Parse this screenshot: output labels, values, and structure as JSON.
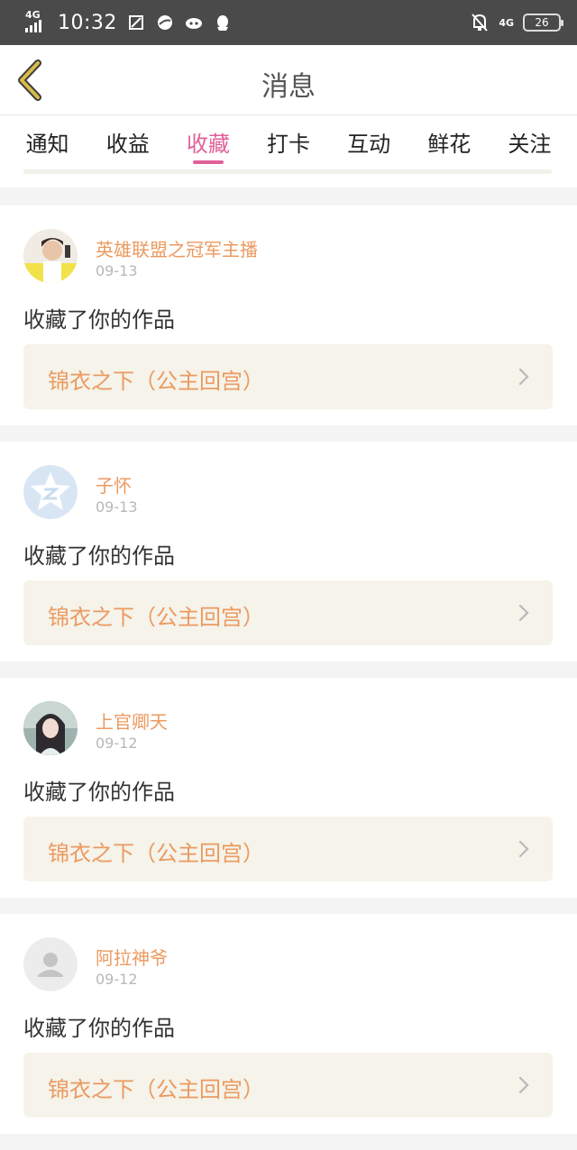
{
  "status_bar": {
    "network": "4G",
    "time": "10:32",
    "right_network": "4G",
    "battery": "26",
    "icons": [
      "signal-icon",
      "sim-icon",
      "browser-icon",
      "cat-icon",
      "qq-icon",
      "bell-off-icon",
      "battery-icon"
    ]
  },
  "header": {
    "title": "消息",
    "back_icon": "back-chevron-icon"
  },
  "tabs": [
    {
      "label": "通知",
      "active": false
    },
    {
      "label": "收益",
      "active": false
    },
    {
      "label": "收藏",
      "active": true
    },
    {
      "label": "打卡",
      "active": false
    },
    {
      "label": "互动",
      "active": false
    },
    {
      "label": "鲜花",
      "active": false
    },
    {
      "label": "关注",
      "active": false
    }
  ],
  "items": [
    {
      "user": "英雄联盟之冠军主播",
      "date": "09-13",
      "action": "收藏了你的作品",
      "work": "锦衣之下（公主回宫）",
      "avatar": "photo-avatar-icon"
    },
    {
      "user": "子怀",
      "date": "09-13",
      "action": "收藏了你的作品",
      "work": "锦衣之下（公主回宫）",
      "avatar": "qzone-star-avatar-icon"
    },
    {
      "user": "上官卿天",
      "date": "09-12",
      "action": "收藏了你的作品",
      "work": "锦衣之下（公主回宫）",
      "avatar": "photo-avatar-icon"
    },
    {
      "user": "阿拉神爷",
      "date": "09-12",
      "action": "收藏了你的作品",
      "work": "锦衣之下（公主回宫）",
      "avatar": "default-user-avatar-icon"
    }
  ],
  "colors": {
    "accent_pink": "#e0609a",
    "name_orange": "#eb9a60",
    "work_bg": "#f5f3ea",
    "back_arrow": "#c8a83a"
  }
}
